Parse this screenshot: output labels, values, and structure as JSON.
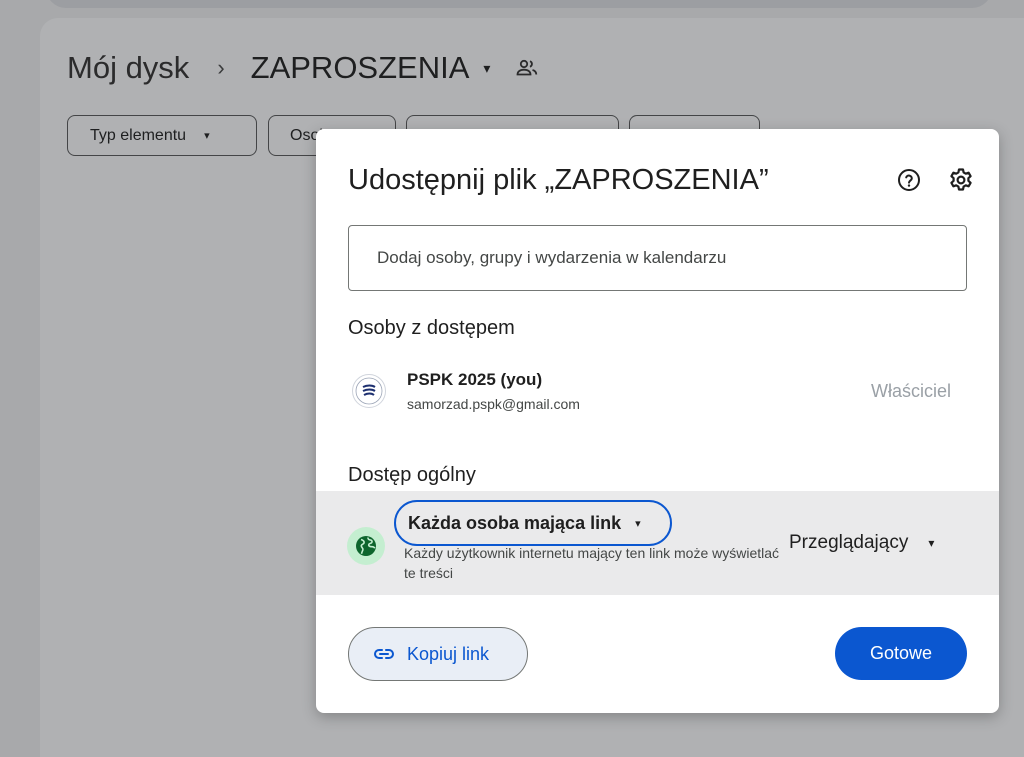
{
  "breadcrumb": {
    "root": "Mój dysk",
    "separator": "›",
    "current": "ZAPROSZENIA",
    "caret": "▾"
  },
  "filters": [
    {
      "label": "Typ elementu",
      "caret": "▾"
    },
    {
      "label": "Osoby",
      "caret": "▾"
    },
    {
      "label": "",
      "caret": ""
    },
    {
      "label": "",
      "caret": ""
    }
  ],
  "dialog": {
    "title": "Udostępnij plik „ZAPROSZENIA”",
    "add_placeholder": "Dodaj osoby, grupy i wydarzenia w kalendarzu",
    "people_section_title": "Osoby z dostępem",
    "people": [
      {
        "name": "PSPK 2025 (you)",
        "email": "samorzad.pspk@gmail.com",
        "role": "Właściciel"
      }
    ],
    "general_section_title": "Dostęp ogólny",
    "general_access": {
      "label": "Każda osoba mająca link",
      "caret": "▾",
      "description": "Każdy użytkownik internetu mający ten link może wyświetlać te treści",
      "role": "Przeglądający",
      "role_caret": "▾"
    },
    "copy_link_label": "Kopiuj link",
    "done_label": "Gotowe"
  },
  "colors": {
    "accent": "#0b57d0",
    "globe_bg": "#c4eed0",
    "globe_icon": "#0d652d",
    "overlay_bg": "#a8a9ab"
  },
  "icons": {
    "shared_folder": "people-icon",
    "help": "help-circle-icon",
    "settings": "gear-icon",
    "globe": "globe-icon",
    "link": "link-icon"
  }
}
